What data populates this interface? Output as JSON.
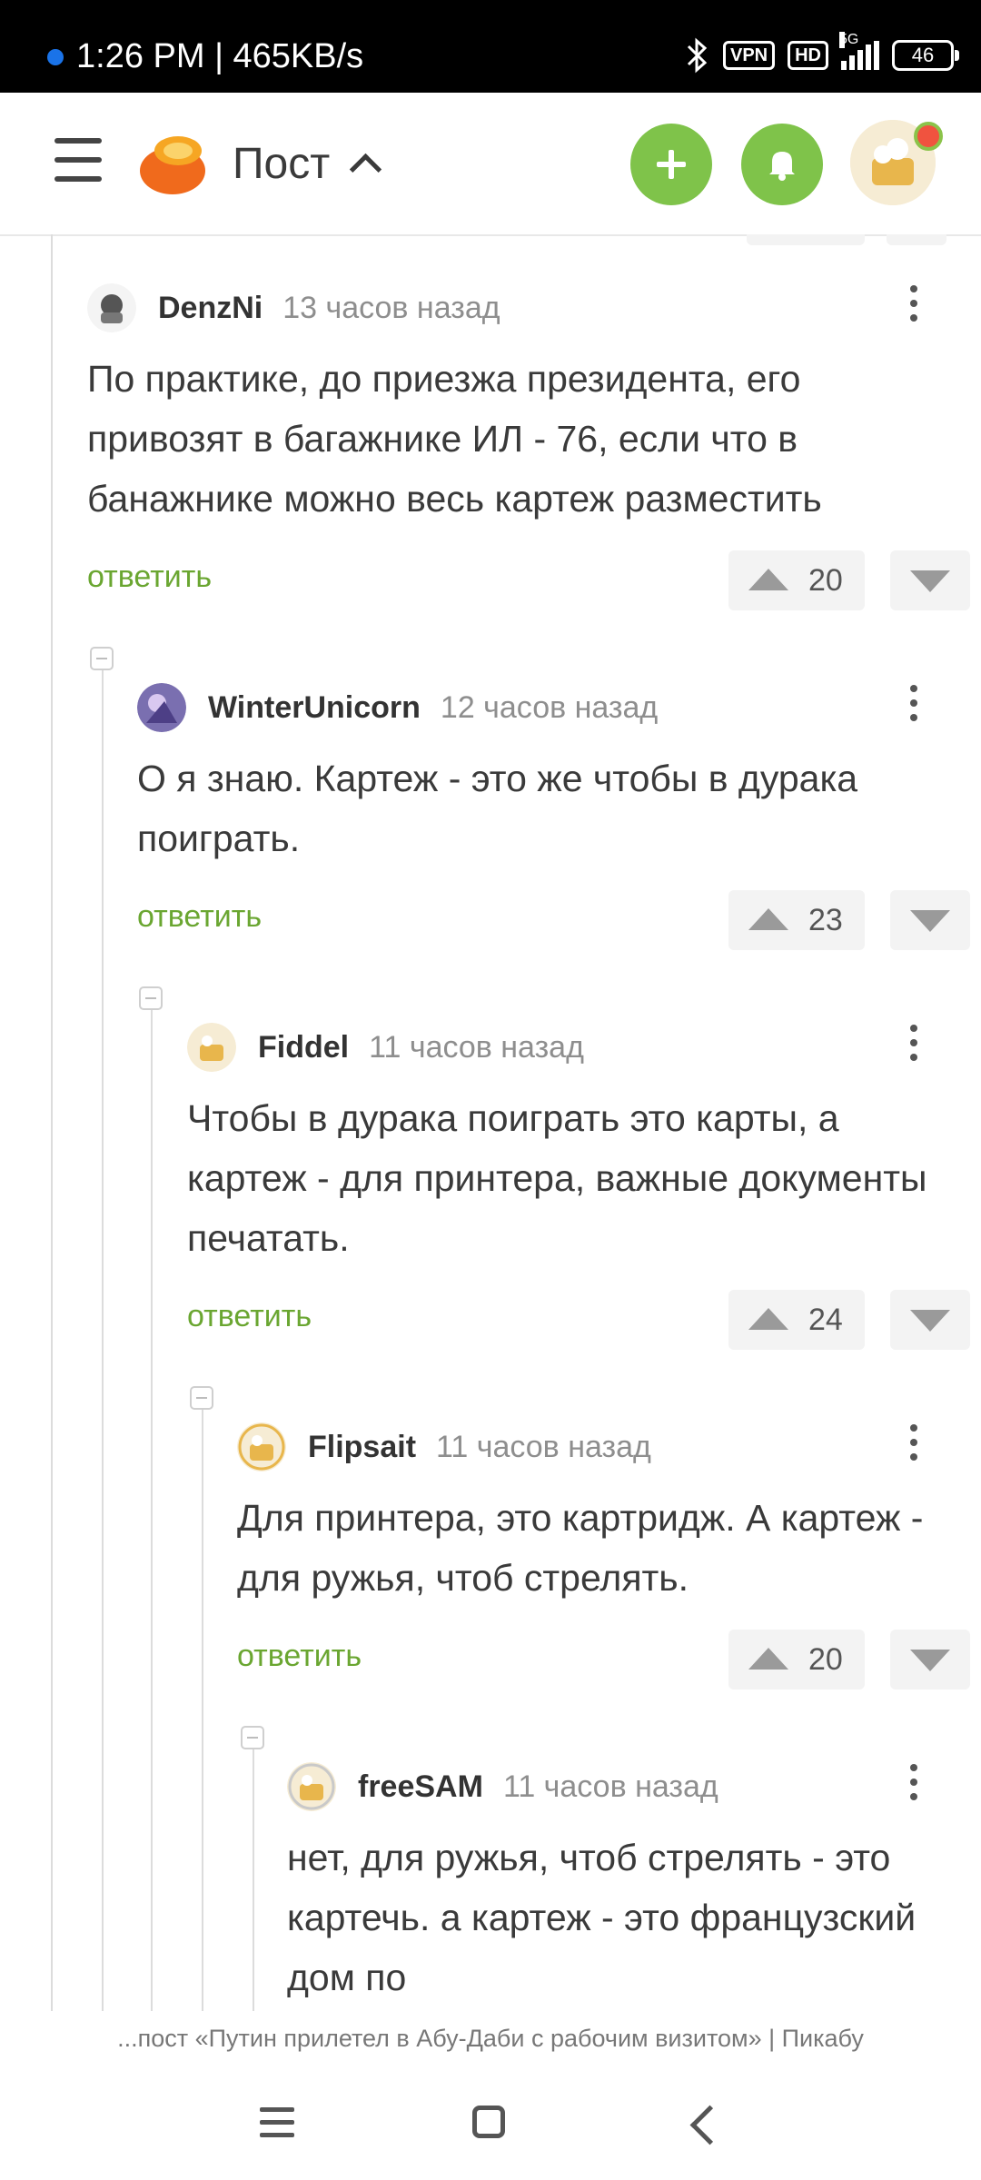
{
  "status_bar": {
    "time": "1:26 PM | 465KB/s",
    "vpn": "VPN",
    "hd": "HD",
    "network": "5G",
    "battery": "46",
    "icons": [
      "bluetooth-icon",
      "vpn-icon",
      "hd-icon",
      "signal-icon",
      "battery-icon"
    ]
  },
  "header": {
    "title": "Пост",
    "icons": [
      "menu-icon",
      "pikabu-logo",
      "chevron-up-icon",
      "plus-icon",
      "bell-icon",
      "avatar"
    ],
    "accent_color": "#7fc34a",
    "badge_color": "#f0533f"
  },
  "comments": [
    {
      "user": "DenzNi",
      "time": "13 часов назад",
      "text": "По практике, до приезжа президента, его привозят в багажнике ИЛ - 76, если что в банажнике можно весь картеж разместить",
      "reply": "ответить",
      "rating": "20"
    },
    {
      "user": "WinterUnicorn",
      "time": "12 часов назад",
      "text": "О я знаю. Картеж - это же чтобы в дурака поиграть.",
      "reply": "ответить",
      "rating": "23"
    },
    {
      "user": "Fiddel",
      "time": "11 часов назад",
      "text": "Чтобы в дурака поиграть это карты, а картеж - для принтера, важные документы печатать.",
      "reply": "ответить",
      "rating": "24"
    },
    {
      "user": "Flipsait",
      "time": "11 часов назад",
      "text": "Для принтера, это картридж. А картеж - для ружья, чтоб стрелять.",
      "reply": "ответить",
      "rating": "20"
    },
    {
      "user": "freeSAM",
      "time": "11 часов назад",
      "text": "нет, для ружья, чтоб стрелять - это картечь. а картеж - это французский дом по",
      "reply": "",
      "rating": ""
    }
  ],
  "footer": {
    "page_url_text": "...пост «Путин прилетел в Абу-Даби с рабочим визитом» | Пикабу"
  },
  "nav": {
    "icons": [
      "recent-apps-icon",
      "home-icon",
      "back-icon"
    ]
  }
}
